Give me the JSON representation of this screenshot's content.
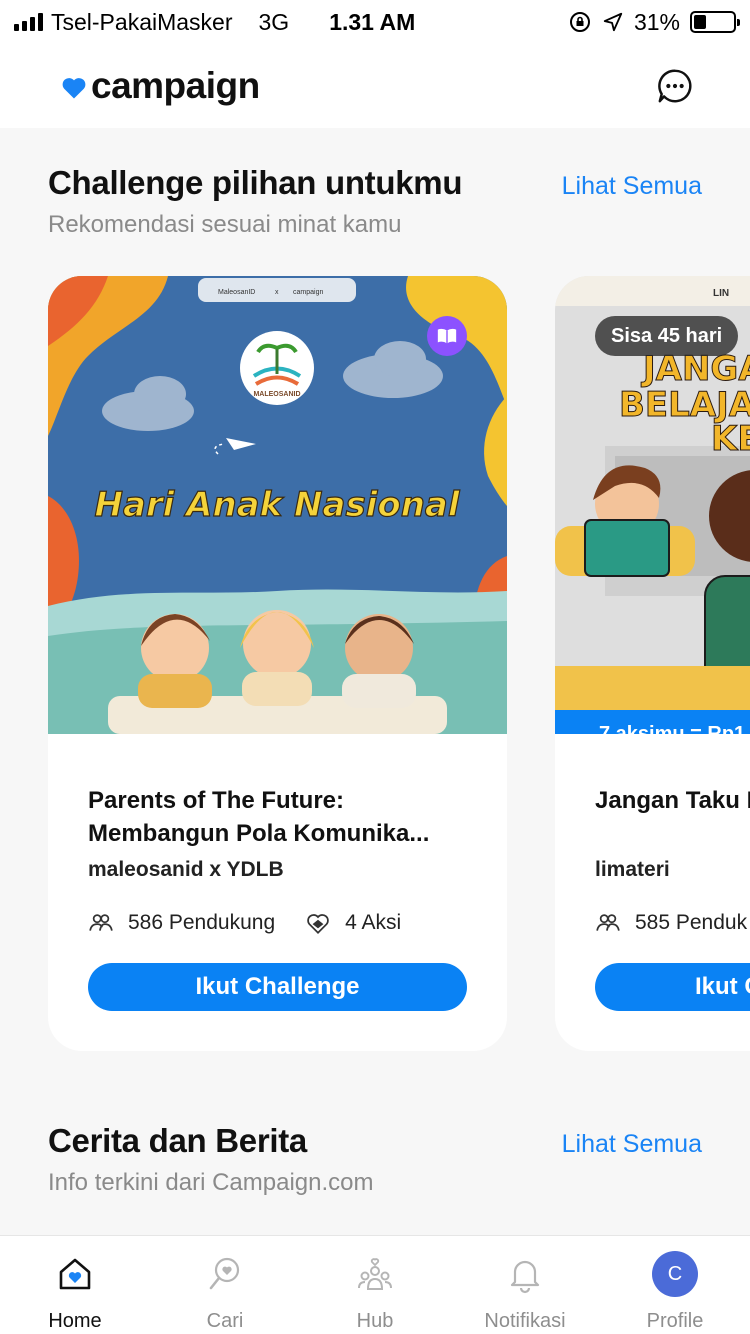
{
  "status": {
    "carrier": "Tsel-PakaiMasker",
    "network": "3G",
    "time": "1.31 AM",
    "battery": "31%",
    "battery_level": 0.31
  },
  "header": {
    "app_name": "campaign",
    "brand_color": "#1a84f5"
  },
  "challenges": {
    "title": "Challenge pilihan untukmu",
    "see_all": "Lihat Semua",
    "subtitle": "Rekomendasi sesuai minat kamu",
    "cards": [
      {
        "image_text": "Hari Anak Nasional",
        "image_header_left": "MaleosanID",
        "image_header_x": "x",
        "image_header_right": "campaign",
        "image_logo_text": "MALEOSANID",
        "title": "Parents of The Future: Membangun Pola Komunika...",
        "organizer": "maleosanid x YDLB",
        "supporters": "586 Pendukung",
        "actions": "4 Aksi",
        "button": "Ikut Challenge"
      },
      {
        "days_left": "Sisa 45 hari",
        "image_text_1": "JANGA",
        "image_text_2": "BELAJA",
        "image_text_3": "KE",
        "image_header_left": "LIN",
        "reward": "7 aksimu = Rp1",
        "title": "Jangan Taku Luar Kelas!",
        "organizer": "limateri",
        "supporters": "585 Penduk",
        "button": "Ikut C"
      }
    ]
  },
  "stories": {
    "title": "Cerita dan Berita",
    "see_all": "Lihat Semua",
    "subtitle": "Info terkini dari Campaign.com"
  },
  "nav": {
    "home": "Home",
    "search": "Cari",
    "hub": "Hub",
    "notifications": "Notifikasi",
    "profile": "Profile",
    "avatar_initial": "C"
  }
}
